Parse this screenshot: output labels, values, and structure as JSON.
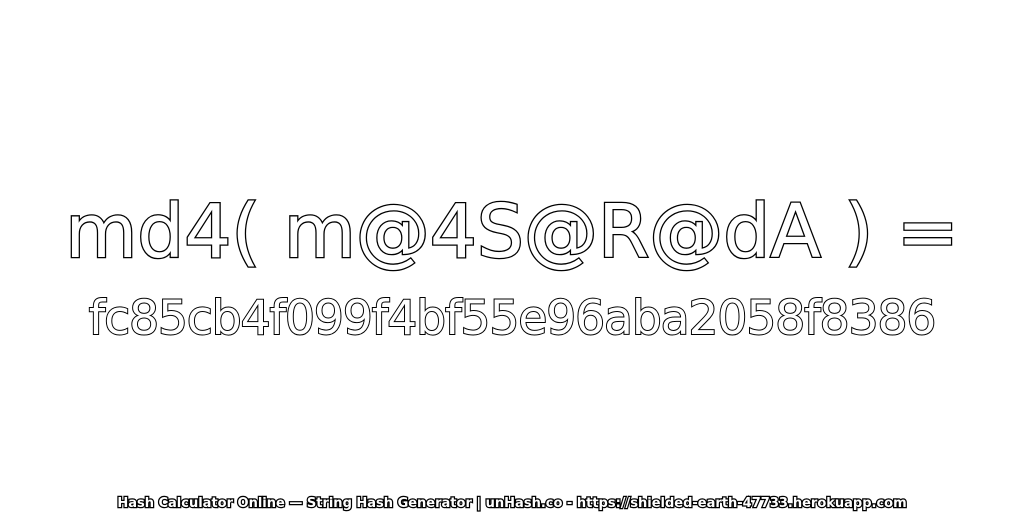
{
  "expression": "md4( m@4S@R@dA ) =",
  "hash": "fc85cb4f099f4bf55e96aba2058f8386",
  "footer": "Hash Calculator Online — String Hash Generator | unHash.co - https://shielded-earth-47733.herokuapp.com",
  "colors": {
    "text_fill": "#ffffff",
    "text_outline": "#000000",
    "background": "#ffffff"
  }
}
